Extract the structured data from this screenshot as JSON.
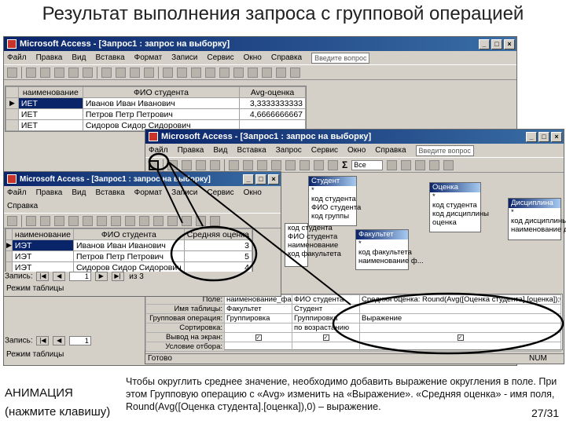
{
  "slide": {
    "title": "Результат выполнения запроса с групповой операцией",
    "animation_label": "АНИМАЦИЯ",
    "animation_hint": "(нажмите клавишу)",
    "caption": "Чтобы округлить среднее значение, необходимо добавить выражение округления в поле. При этом Групповую операцию с «Avg» изменить на «Выражение». «Средняя оценка» - имя поля, Round(Avg([Оценка студента].[оценка]),0) – выражение.",
    "page": "27/31"
  },
  "window1": {
    "title": "Microsoft Access - [Запрос1 : запрос на выборку]",
    "menu": [
      "Файл",
      "Правка",
      "Вид",
      "Вставка",
      "Формат",
      "Записи",
      "Сервис",
      "Окно",
      "Справка"
    ],
    "help_placeholder": "Введите вопрос",
    "columns": [
      "наименование",
      "ФИО студента",
      "Avg-оценка"
    ],
    "rows": [
      [
        "ИЕТ",
        "Иванов Иван Иванович",
        "3,3333333333"
      ],
      [
        "ИЕТ",
        "Петров Петр Петрович",
        "4,6666666667"
      ],
      [
        "ИЕТ",
        "Сидоров Сидор Сидорович",
        ""
      ]
    ]
  },
  "window2": {
    "title": "Microsoft Access - [Запрос1 : запрос на выборку]",
    "menu": [
      "Файл",
      "Правка",
      "Вид",
      "Вставка",
      "Запрос",
      "Сервис",
      "Окно",
      "Справка"
    ],
    "help_placeholder": "Введите вопрос",
    "toolbar_dropdown": "Все",
    "tables": {
      "student": {
        "title": "Студент",
        "fields": [
          "*",
          "код студента",
          "ФИО студента",
          "код группы"
        ]
      },
      "ocenka": {
        "title": "Оценка студ...",
        "fields": [
          "*",
          "код студента",
          "код дисциплины",
          "оценка"
        ]
      },
      "disciplina": {
        "title": "Дисциплина",
        "fields": [
          "*",
          "код дисциплины",
          "наименование д..."
        ]
      },
      "fakultet": {
        "title": "Факультет",
        "fields": [
          "*",
          "код факультета",
          "наименование ф..."
        ]
      },
      "gruppa_fields": [
        "код студента",
        "ФИО студента",
        "наименование",
        "код факультета"
      ]
    },
    "qbe": {
      "row_labels": [
        "Поле:",
        "Имя таблицы:",
        "Групповая операция:",
        "Сортировка:",
        "Вывод на экран:",
        "Условие отбора:",
        "или:"
      ],
      "columns": [
        [
          "наименование_фак",
          "Факультет",
          "Группировка",
          "",
          "✓",
          "",
          ""
        ],
        [
          "ФИО студента",
          "Студент",
          "Группировка",
          "по возрастанию",
          "✓",
          "",
          ""
        ],
        [
          "Средняя оценка: Round(Avg([Оценка студента].[оценка]);0)",
          "",
          "Выражение",
          "",
          "✓",
          "",
          ""
        ]
      ]
    },
    "status_left": "Готово",
    "status_right": "NUM"
  },
  "window3": {
    "title": "Microsoft Access - [Запрос1 : запрос на выборку]",
    "menu": [
      "Файл",
      "Правка",
      "Вид",
      "Вставка",
      "Формат",
      "Записи",
      "Сервис",
      "Окно"
    ],
    "menu2": [
      "Справка"
    ],
    "columns": [
      "наименование",
      "ФИО студента",
      "Средняя оценка"
    ],
    "rows": [
      [
        "ИЭТ",
        "Иванов Иван Иванович",
        "3"
      ],
      [
        "ИЭТ",
        "Петров Петр Петрович",
        "5"
      ],
      [
        "ИЭТ",
        "Сидоров Сидор Сидорович",
        "4"
      ]
    ],
    "nav_label": "Запись:",
    "nav_current": "1",
    "nav_total": "из 3",
    "mode": "Режим таблицы"
  },
  "window1_nav": {
    "nav_label": "Запись:",
    "nav_current": "1",
    "mode": "Режим таблицы"
  }
}
